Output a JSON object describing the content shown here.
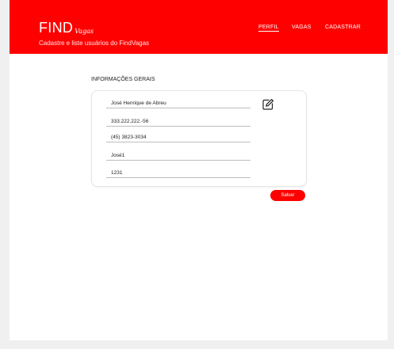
{
  "header": {
    "brand_main": "FIND",
    "brand_script": "Vagas",
    "subtitle": "Cadastre e liste usuários do FindVagas",
    "nav": {
      "perfil": "PERFIL",
      "vagas": "VAGAS",
      "cadastrar": "CADASTRAR",
      "active": "perfil"
    }
  },
  "section": {
    "title": "INFORMAÇÕES GERAIS"
  },
  "form": {
    "name": "José Henrique de Abreu",
    "cpf": "333.222.222.-56",
    "phone": "(45) 3823-3034",
    "username": "José1",
    "password": "1231"
  },
  "actions": {
    "edit_icon": "edit-icon",
    "save_label": "Salvar"
  },
  "colors": {
    "brand_red": "#ff0000",
    "background": "#f0f0f0"
  }
}
